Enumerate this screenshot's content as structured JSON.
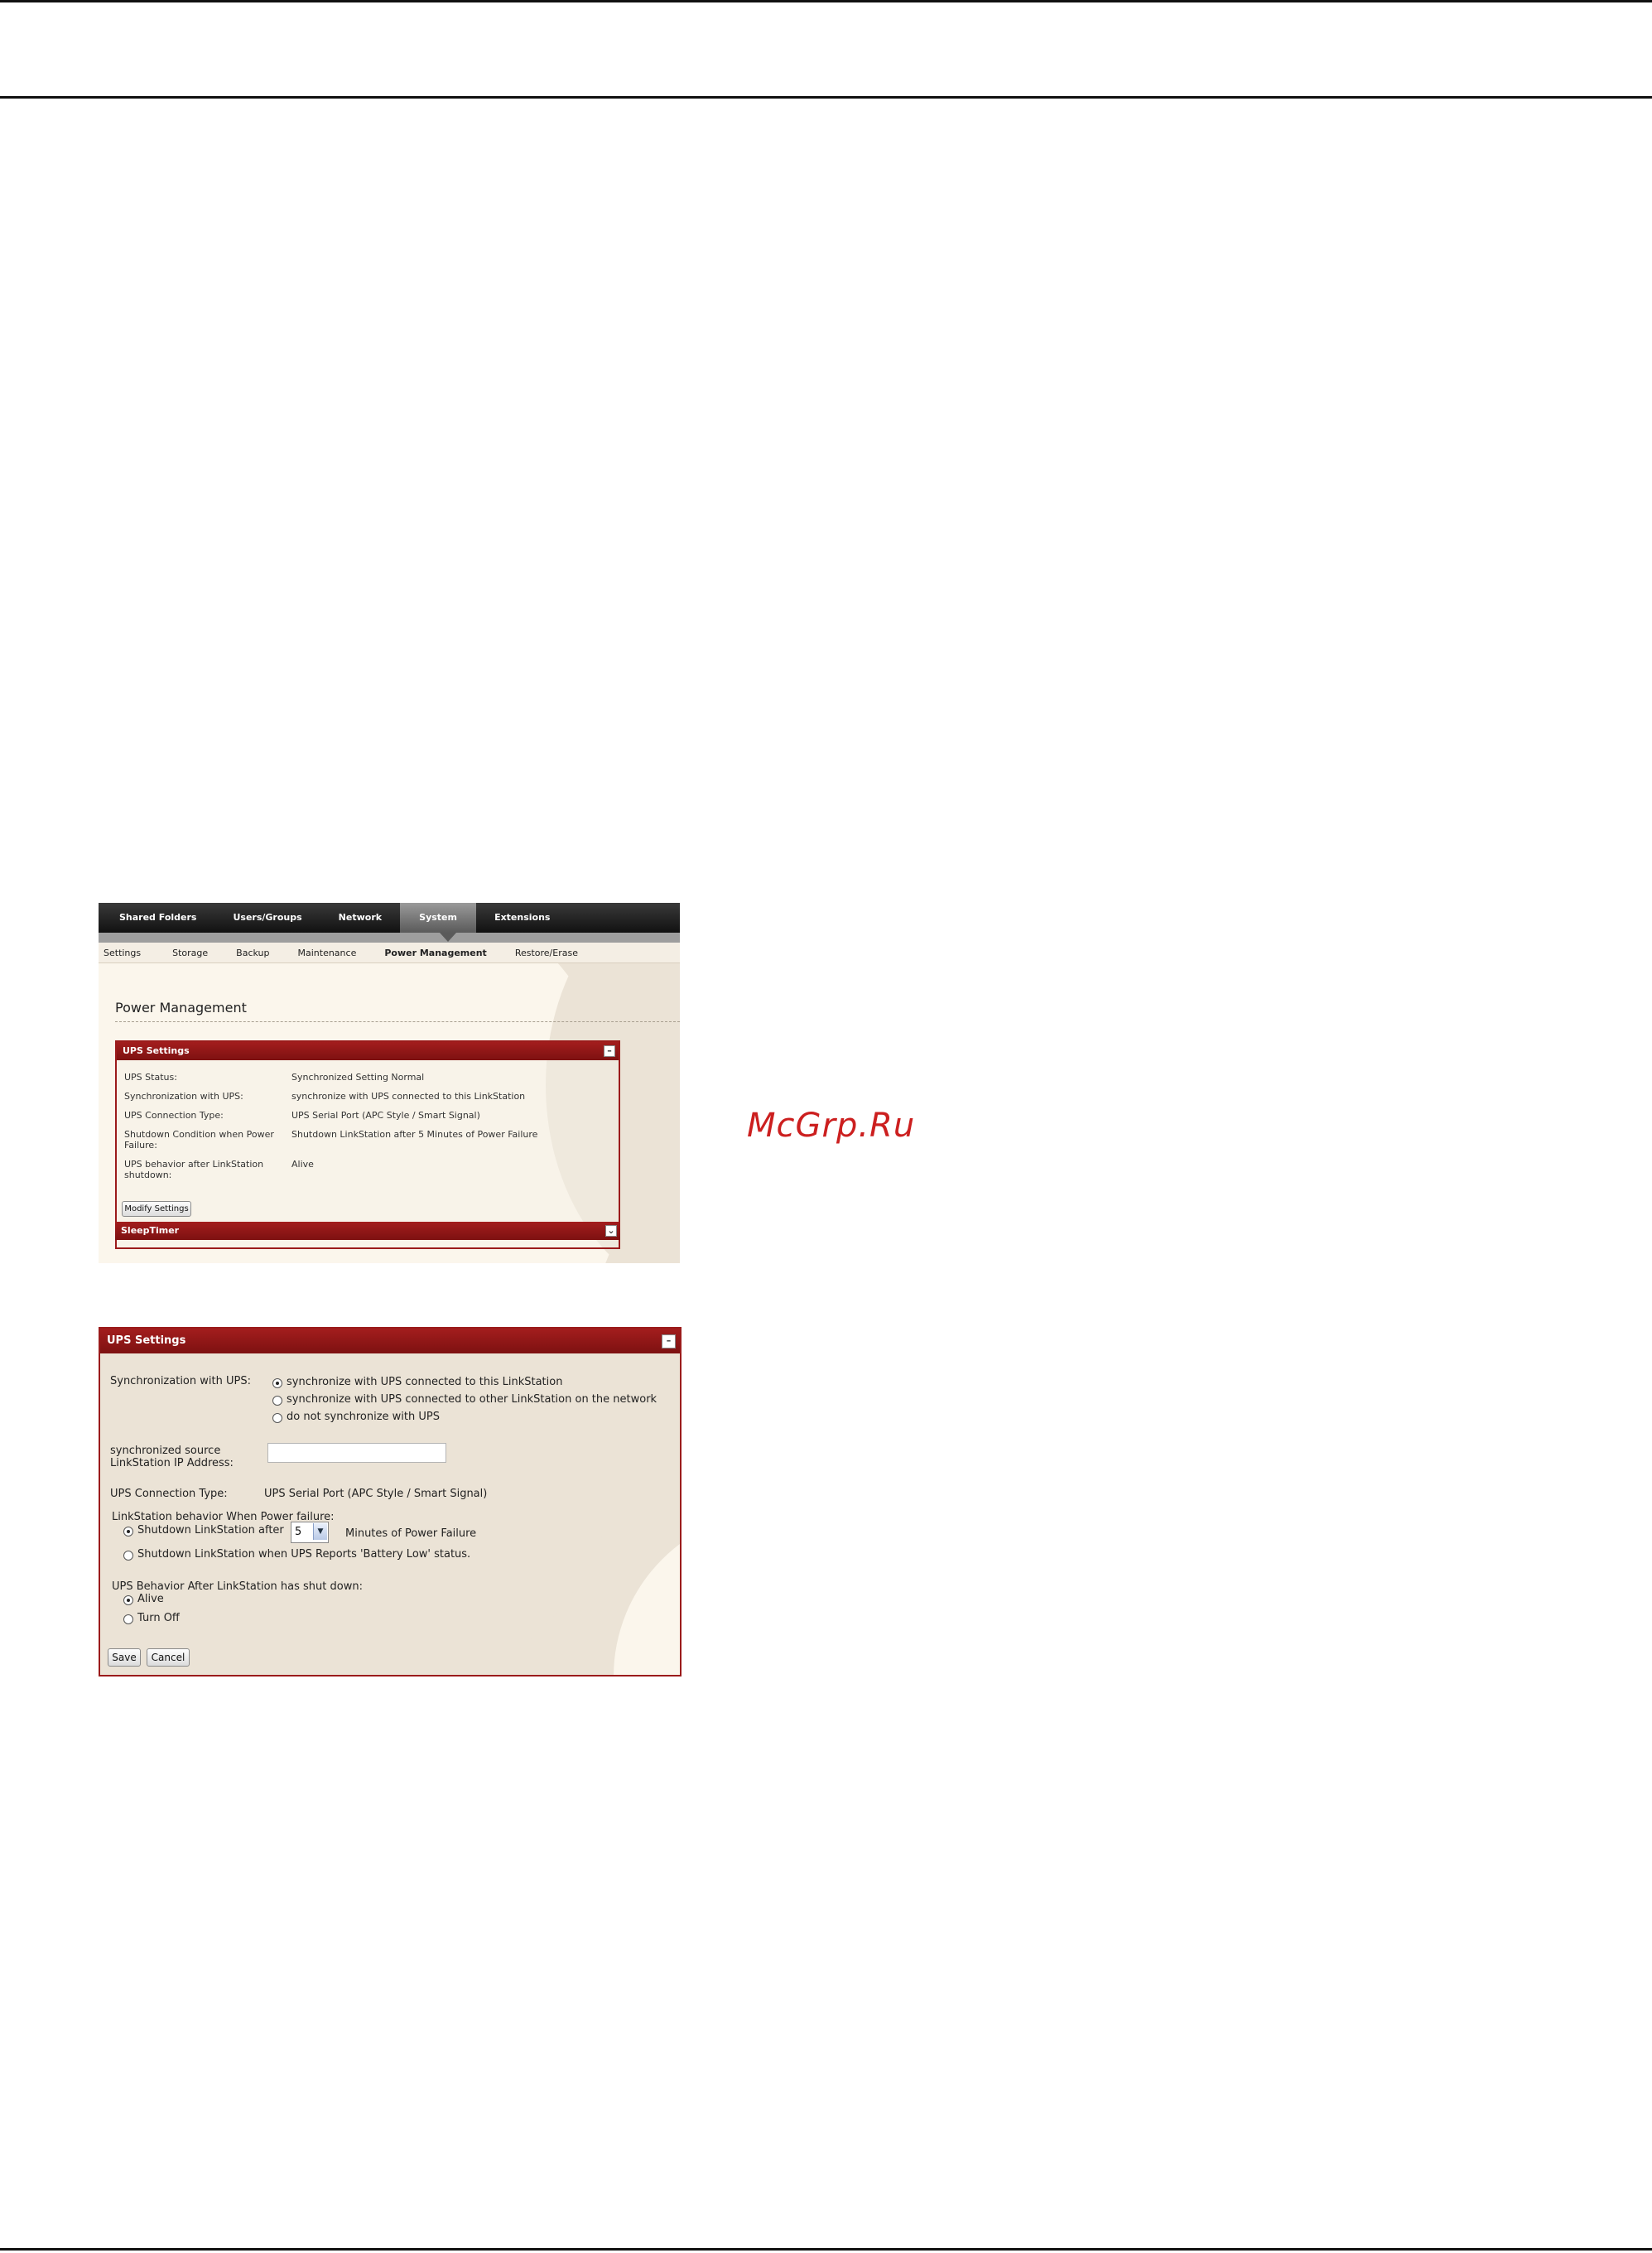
{
  "watermark": "McGrp.Ru",
  "shot1": {
    "nav_tabs": [
      "Shared Folders",
      "Users/Groups",
      "Network",
      "System",
      "Extensions"
    ],
    "active_tab": "System",
    "sub_tabs": [
      "Settings",
      "Storage",
      "Backup",
      "Maintenance",
      "Power Management",
      "Restore/Erase"
    ],
    "active_sub_tab": "Power Management",
    "page_title": "Power Management",
    "panel_title": "UPS Settings",
    "rows": [
      {
        "label": "UPS Status:",
        "value": "Synchronized Setting Normal"
      },
      {
        "label": "Synchronization with UPS:",
        "value": "synchronize with UPS connected to this LinkStation"
      },
      {
        "label": "UPS Connection Type:",
        "value": "UPS Serial Port (APC Style / Smart Signal)"
      },
      {
        "label": "Shutdown Condition when Power Failure:",
        "value": "Shutdown LinkStation after 5 Minutes of Power Failure"
      },
      {
        "label": "UPS behavior after LinkStation shutdown:",
        "value": "Alive"
      }
    ],
    "modify_button": "Modify Settings",
    "sleep_panel_title": "SleepTimer"
  },
  "shot2": {
    "title": "UPS Settings",
    "sync_label": "Synchronization with UPS:",
    "sync_options": [
      {
        "label": "synchronize with UPS connected to this LinkStation",
        "selected": true
      },
      {
        "label": "synchronize with UPS connected to other LinkStation on the network",
        "selected": false
      },
      {
        "label": "do not synchronize with UPS",
        "selected": false
      }
    ],
    "ip_label_line1": "synchronized source",
    "ip_label_line2": "LinkStation IP Address:",
    "ip_value": "",
    "conn_label": "UPS Connection Type:",
    "conn_value": "UPS Serial Port (APC Style / Smart Signal)",
    "power_label": "LinkStation behavior When Power failure:",
    "shutdown_after": "Shutdown LinkStation after",
    "minutes_value": "5",
    "minutes_suffix": "Minutes of Power Failure",
    "battery_low": "Shutdown LinkStation when UPS Reports 'Battery Low' status.",
    "after_label": "UPS Behavior After LinkStation has shut down:",
    "alive": "Alive",
    "turn_off": "Turn Off",
    "save": "Save",
    "cancel": "Cancel"
  }
}
